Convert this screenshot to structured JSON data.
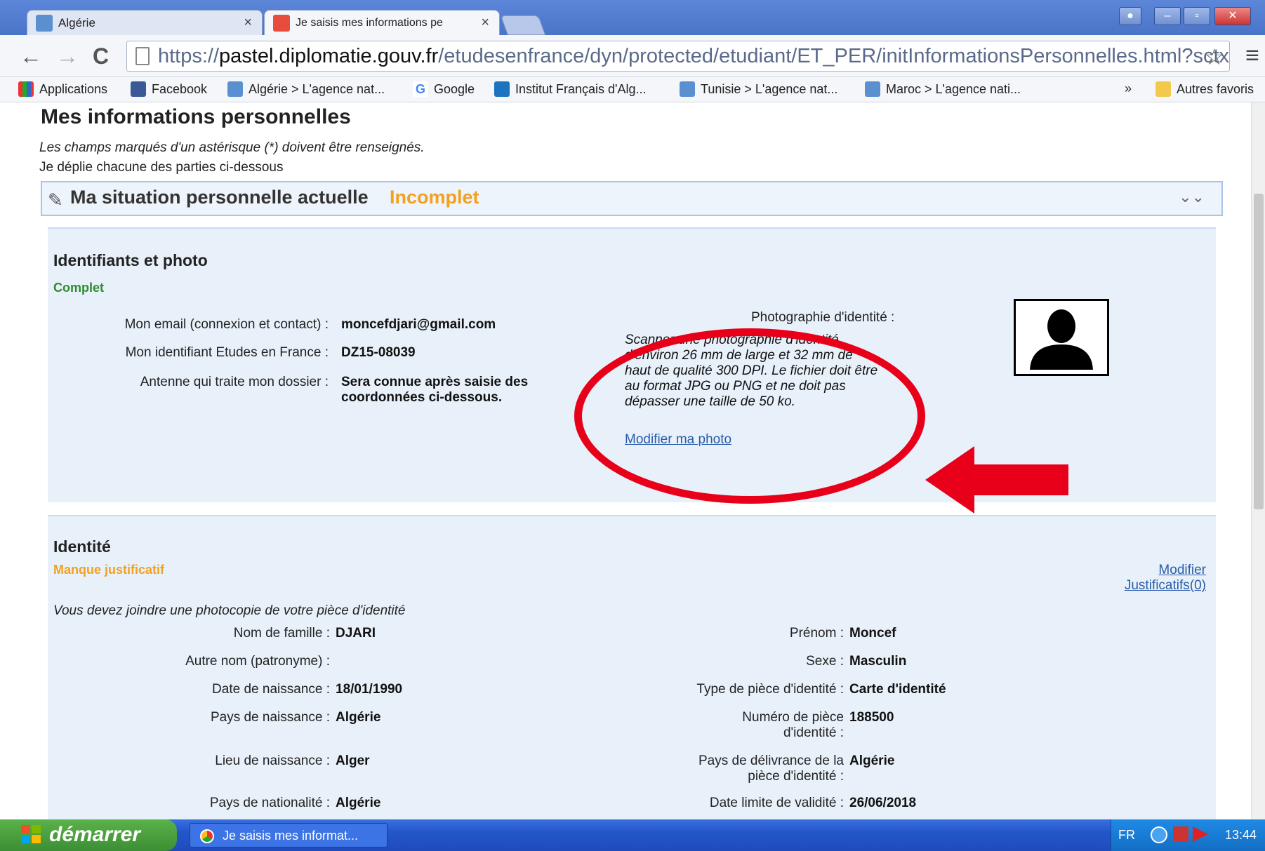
{
  "browser": {
    "tabs": [
      {
        "label": "Algérie",
        "close": "×"
      },
      {
        "label": "Je saisis mes informations pe",
        "close": "×"
      }
    ],
    "url": {
      "scheme": "https://",
      "host": "pastel.diplomatie.gouv.fr",
      "path": "/etudesenfrance/dyn/protected/etudiant/ET_PER/initInformationsPersonnelles.html?sctx"
    },
    "bookmarks": [
      {
        "label": "Applications",
        "icon": "apps-grid-icon"
      },
      {
        "label": "Facebook",
        "icon": "facebook-icon"
      },
      {
        "label": "Algérie > L'agence nat...",
        "icon": "campus-france-icon"
      },
      {
        "label": "Google",
        "icon": "google-icon"
      },
      {
        "label": "Institut Français d'Alg...",
        "icon": "if-icon"
      },
      {
        "label": "Tunisie > L'agence nat...",
        "icon": "campus-france-icon"
      },
      {
        "label": "Maroc > L'agence nati...",
        "icon": "campus-france-icon"
      },
      {
        "label": "»",
        "icon": ""
      },
      {
        "label": "Autres favoris",
        "icon": "folder-icon"
      }
    ],
    "colors": {
      "tabstrip": "#5c86d8",
      "accent_red": "#e8001a"
    }
  },
  "page": {
    "title": "Mes informations personnelles",
    "intro_required": "Les champs marqués d'un astérisque (*) doivent être renseignés.",
    "intro_unfold": "Je déplie chacune des parties ci-dessous",
    "section": {
      "title": "Ma situation personnelle actuelle",
      "status": "Incomplet",
      "chevron": "»"
    },
    "identifiants": {
      "heading": "Identifiants et photo",
      "status": "Complet",
      "fields": [
        {
          "label": "Mon email (connexion et contact) :",
          "value": "moncefdjari@gmail.com"
        },
        {
          "label": "Mon identifiant Etudes en France :",
          "value": "DZ15-08039"
        },
        {
          "label": "Antenne qui traite mon dossier :",
          "value_line1": "Sera connue après saisie des",
          "value_line2": "coordonnées ci-dessous."
        }
      ],
      "photo_label": "Photographie d'identité :",
      "photo_desc_lines": [
        "Scanner une photographie d'identité",
        "d'environ 26 mm de large et 32 mm de",
        "haut de qualité 300 DPI. Le fichier doit être",
        "au format JPG ou PNG et ne doit pas",
        "dépasser une taille de 50 ko."
      ],
      "photo_link": "Modifier ma photo"
    },
    "identite": {
      "heading": "Identité",
      "status": "Manque justificatif",
      "link_modify": "Modifier",
      "link_docs": "Justificatifs(0)",
      "notice": "Vous devez joindre une photocopie de votre pièce d'identité",
      "left_fields": [
        {
          "label": "Nom de famille :",
          "value": "DJARI"
        },
        {
          "label": "Autre nom (patronyme) :",
          "value": ""
        },
        {
          "label": "Date de naissance :",
          "value": "18/01/1990"
        },
        {
          "label": "Pays de naissance :",
          "value": "Algérie"
        },
        {
          "label": "Lieu de naissance :",
          "value": "Alger"
        },
        {
          "label": "Pays de nationalité :",
          "value": "Algérie"
        }
      ],
      "right_fields": [
        {
          "label": "Prénom :",
          "value": "Moncef"
        },
        {
          "label": "Sexe :",
          "value": "Masculin"
        },
        {
          "label": "Type de pièce d'identité :",
          "value": "Carte d'identité"
        },
        {
          "label_line1": "Numéro de pièce",
          "label_line2": "d'identité :",
          "value": "188500"
        },
        {
          "label_line1": "Pays de délivrance de la",
          "label_line2": "pièce d'identité :",
          "value": "Algérie"
        },
        {
          "label": "Date limite de validité :",
          "value": "26/06/2018"
        }
      ]
    }
  },
  "taskbar": {
    "start_label": "démarrer",
    "window_label": "Je saisis mes informat...",
    "lang": "FR",
    "clock": "13:44"
  }
}
